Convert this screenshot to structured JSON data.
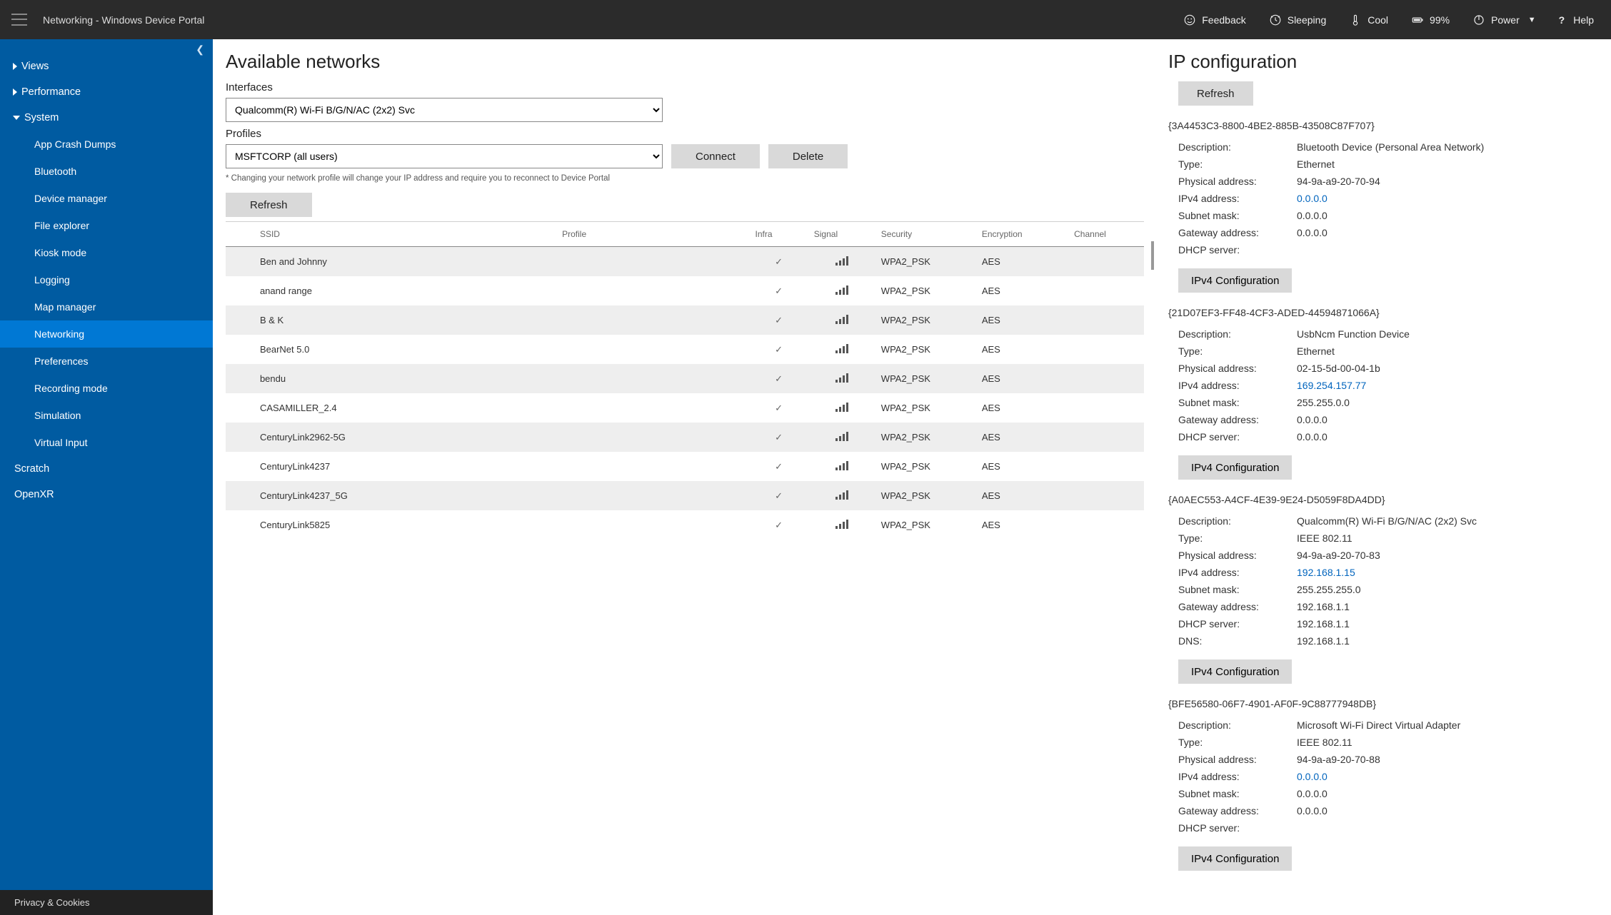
{
  "topbar": {
    "title": "Networking - Windows Device Portal",
    "feedback": "Feedback",
    "sleeping": "Sleeping",
    "cool": "Cool",
    "battery": "99%",
    "power": "Power",
    "help": "Help"
  },
  "sidebar": {
    "groups": [
      {
        "label": "Views",
        "expanded": false
      },
      {
        "label": "Performance",
        "expanded": false
      },
      {
        "label": "System",
        "expanded": true
      }
    ],
    "system_children": [
      "App Crash Dumps",
      "Bluetooth",
      "Device manager",
      "File explorer",
      "Kiosk mode",
      "Logging",
      "Map manager",
      "Networking",
      "Preferences",
      "Recording mode",
      "Simulation",
      "Virtual Input"
    ],
    "system_active_index": 7,
    "extra": [
      "Scratch",
      "OpenXR"
    ],
    "footer": "Privacy & Cookies"
  },
  "available": {
    "heading": "Available networks",
    "interfaces_label": "Interfaces",
    "interface_selected": "Qualcomm(R) Wi-Fi B/G/N/AC (2x2) Svc",
    "profiles_label": "Profiles",
    "profile_selected": "MSFTCORP (all users)",
    "connect": "Connect",
    "delete": "Delete",
    "hint": "* Changing your network profile will change your IP address and require you to reconnect to Device Portal",
    "refresh": "Refresh",
    "columns": [
      "",
      "SSID",
      "Profile",
      "Infra",
      "Signal",
      "Security",
      "Encryption",
      "Channel"
    ],
    "rows": [
      {
        "ssid": "Ben and Johnny",
        "profile": "",
        "infra": true,
        "security": "WPA2_PSK",
        "encryption": "AES",
        "channel": ""
      },
      {
        "ssid": "anand range",
        "profile": "",
        "infra": true,
        "security": "WPA2_PSK",
        "encryption": "AES",
        "channel": ""
      },
      {
        "ssid": "B & K",
        "profile": "",
        "infra": true,
        "security": "WPA2_PSK",
        "encryption": "AES",
        "channel": ""
      },
      {
        "ssid": "BearNet 5.0",
        "profile": "",
        "infra": true,
        "security": "WPA2_PSK",
        "encryption": "AES",
        "channel": ""
      },
      {
        "ssid": "bendu",
        "profile": "",
        "infra": true,
        "security": "WPA2_PSK",
        "encryption": "AES",
        "channel": ""
      },
      {
        "ssid": "CASAMILLER_2.4",
        "profile": "",
        "infra": true,
        "security": "WPA2_PSK",
        "encryption": "AES",
        "channel": ""
      },
      {
        "ssid": "CenturyLink2962-5G",
        "profile": "",
        "infra": true,
        "security": "WPA2_PSK",
        "encryption": "AES",
        "channel": ""
      },
      {
        "ssid": "CenturyLink4237",
        "profile": "",
        "infra": true,
        "security": "WPA2_PSK",
        "encryption": "AES",
        "channel": ""
      },
      {
        "ssid": "CenturyLink4237_5G",
        "profile": "",
        "infra": true,
        "security": "WPA2_PSK",
        "encryption": "AES",
        "channel": ""
      },
      {
        "ssid": "CenturyLink5825",
        "profile": "",
        "infra": true,
        "security": "WPA2_PSK",
        "encryption": "AES",
        "channel": ""
      }
    ]
  },
  "ipconfig": {
    "heading": "IP configuration",
    "refresh": "Refresh",
    "config_btn": "IPv4 Configuration",
    "labels": {
      "description": "Description:",
      "type": "Type:",
      "physical": "Physical address:",
      "ipv4": "IPv4 address:",
      "subnet": "Subnet mask:",
      "gateway": "Gateway address:",
      "dhcp": "DHCP server:",
      "dns": "DNS:"
    },
    "adapters": [
      {
        "id": "{3A4453C3-8800-4BE2-885B-43508C87F707}",
        "description": "Bluetooth Device (Personal Area Network)",
        "type": "Ethernet",
        "physical": "94-9a-a9-20-70-94",
        "ipv4": "0.0.0.0",
        "subnet": "0.0.0.0",
        "gateway": "0.0.0.0",
        "dhcp": ""
      },
      {
        "id": "{21D07EF3-FF48-4CF3-ADED-44594871066A}",
        "description": "UsbNcm Function Device",
        "type": "Ethernet",
        "physical": "02-15-5d-00-04-1b",
        "ipv4": "169.254.157.77",
        "subnet": "255.255.0.0",
        "gateway": "0.0.0.0",
        "dhcp": "0.0.0.0"
      },
      {
        "id": "{A0AEC553-A4CF-4E39-9E24-D5059F8DA4DD}",
        "description": "Qualcomm(R) Wi-Fi B/G/N/AC (2x2) Svc",
        "type": "IEEE 802.11",
        "physical": "94-9a-a9-20-70-83",
        "ipv4": "192.168.1.15",
        "subnet": "255.255.255.0",
        "gateway": "192.168.1.1",
        "dhcp": "192.168.1.1",
        "dns": "192.168.1.1"
      },
      {
        "id": "{BFE56580-06F7-4901-AF0F-9C88777948DB}",
        "description": "Microsoft Wi-Fi Direct Virtual Adapter",
        "type": "IEEE 802.11",
        "physical": "94-9a-a9-20-70-88",
        "ipv4": "0.0.0.0",
        "subnet": "0.0.0.0",
        "gateway": "0.0.0.0",
        "dhcp": ""
      }
    ]
  }
}
